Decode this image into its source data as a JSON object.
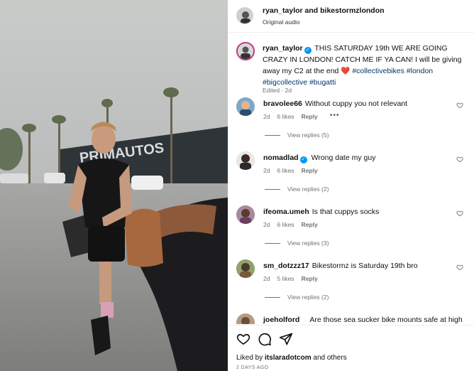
{
  "video": {
    "sign_text": "PRIMAUTOS"
  },
  "header": {
    "title": "ryan_taylor and bikestormzlondon",
    "subtitle": "Original audio"
  },
  "caption": {
    "username": "ryan_taylor",
    "text_main": "THIS SATURDAY 19th WE ARE GOING CRAZY IN LONDON! CATCH ME IF YA CAN! I will be giving away my C2 at the end",
    "heart": "❤️",
    "hashtags": "#collectivebikes #london #bigcollective #bugatti",
    "meta": "Edited · 2d"
  },
  "comments": [
    {
      "username": "bravolee66",
      "verified": false,
      "text": "Without cuppy you not relevant",
      "age": "2d",
      "likes": "6 likes",
      "reply": "Reply",
      "view_replies": "View replies (5)",
      "has_more": true
    },
    {
      "username": "nomadlad",
      "verified": true,
      "text": "Wrong date my guy",
      "age": "2d",
      "likes": "6 likes",
      "reply": "Reply",
      "view_replies": "View replies (2)",
      "has_more": false
    },
    {
      "username": "ifeoma.umeh",
      "verified": false,
      "text": "Is that cuppys socks",
      "age": "2d",
      "likes": "6 likes",
      "reply": "Reply",
      "view_replies": "View replies (3)",
      "has_more": false
    },
    {
      "username": "sm_dotzzz17",
      "verified": false,
      "text": "Bikestormz is Saturday 19th bro",
      "age": "2d",
      "likes": "5 likes",
      "reply": "Reply",
      "view_replies": "View replies (2)",
      "has_more": false
    },
    {
      "username": "joeholford",
      "verified": false,
      "text": "Are those sea sucker bike mounts safe at high",
      "age": "",
      "likes": "",
      "reply": "",
      "view_replies": "",
      "has_more": false
    }
  ],
  "actions": {
    "likes_prefix": "Liked by",
    "likes_user": "itslaradotcom",
    "likes_suffix": "and others",
    "timestamp": "2 DAYS AGO"
  },
  "icons": {
    "like": "heart-outline-icon",
    "comment": "comment-bubble-icon",
    "share": "paper-plane-icon",
    "verified": "verified-badge-icon",
    "options": "more-horizontal-icon",
    "comment_like": "heart-small-icon"
  },
  "colors": {
    "link": "#00376b",
    "verified": "#0095f6",
    "secondary_text": "#737373",
    "heart": "#ed4956",
    "story_ring": "#c13584"
  }
}
